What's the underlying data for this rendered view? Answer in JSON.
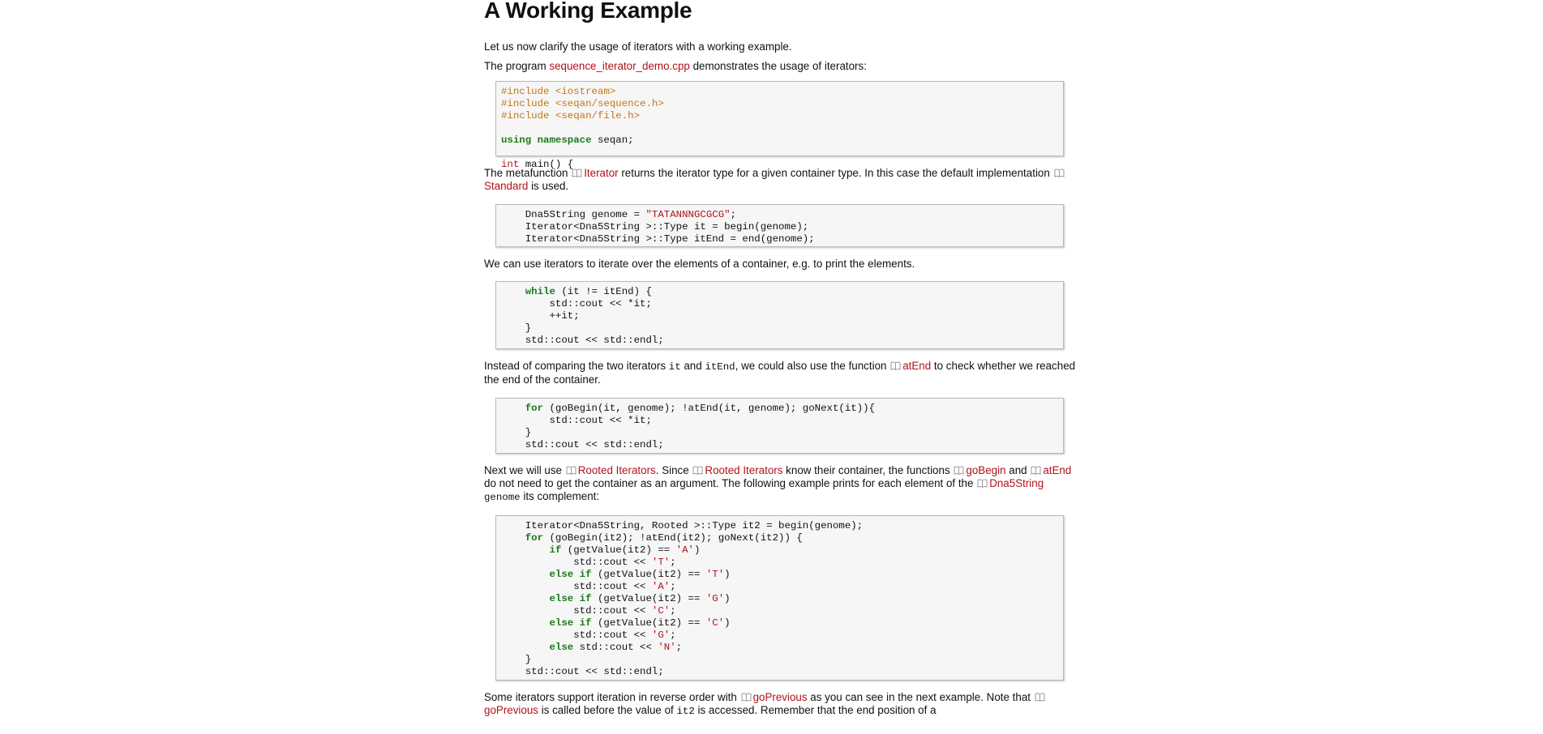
{
  "section": {
    "title": "A Working Example"
  },
  "p1": {
    "text": "Let us now clarify the usage of iterators with a working example."
  },
  "p2": {
    "before": "The program ",
    "link": "sequence_iterator_demo.cpp",
    "after": " demonstrates the usage of iterators:"
  },
  "code1": {
    "include1": "#include <iostream>",
    "include2": "#include <seqan/sequence.h>",
    "include3": "#include <seqan/file.h>",
    "kw_using": "using",
    "kw_namespace": "namespace",
    "ns": " seqan;",
    "kw_int": "int",
    "main": " main() {"
  },
  "p3": {
    "before": "The metafunction ",
    "link1": "Iterator",
    "middle": " returns the iterator type for a given container type. In this case the default implementation ",
    "link2": "Standard",
    "after": " is used."
  },
  "code2": {
    "l1a": "    Dna5String genome = ",
    "l1s": "\"TATANNNGCGCG\"",
    "l1b": ";",
    "l2": "    Iterator<Dna5String >::Type it = begin(genome);",
    "l3": "    Iterator<Dna5String >::Type itEnd = end(genome);"
  },
  "p4": {
    "text": "We can use iterators to iterate over the elements of a container, e.g. to print the elements."
  },
  "code3": {
    "kw_while": "while",
    "l1": " (it != itEnd) {",
    "l2": "        std::cout << *it;",
    "l3": "        ++it;",
    "l4": "    }",
    "l5": "    std::cout << std::endl;"
  },
  "p5": {
    "before": "Instead of comparing the two iterators ",
    "code1": "it",
    "and": " and ",
    "code2": "itEnd",
    "middle": ", we could also use the function ",
    "link": "atEnd",
    "after": " to check whether we reached the end of the container."
  },
  "code4": {
    "kw_for": "for",
    "l1": " (goBegin(it, genome); !atEnd(it, genome); goNext(it)){",
    "l2": "        std::cout << *it;",
    "l3": "    }",
    "l4": "    std::cout << std::endl;"
  },
  "p6": {
    "t1": "Next we will use ",
    "link1": "Rooted Iterators",
    "t2": ". Since ",
    "link2": "Rooted Iterators",
    "t3": " know their container, the functions ",
    "link3": "goBegin",
    "t4": " and ",
    "link4": "atEnd",
    "t5": " do not need to get the container as an argument. The following example prints for each element of the ",
    "link5": "Dna5String",
    "code": "genome",
    "t6": " its complement:"
  },
  "code5": {
    "l1": "    Iterator<Dna5String, Rooted >::Type it2 = begin(genome);",
    "kw_for": "for",
    "l2": " (goBegin(it2); !atEnd(it2); goNext(it2)) {",
    "kw_if": "if",
    "kw_else": "else",
    "kw_elseif": "else if",
    "c1": " (getValue(it2) == ",
    "c_end": ")",
    "out": "            std::cout << ",
    "semi": ";",
    "chA": "'A'",
    "chT": "'T'",
    "chG": "'G'",
    "chC": "'C'",
    "chN": "'N'",
    "else_out": " std::cout << ",
    "close": "    }",
    "endl": "    std::cout << std::endl;"
  },
  "p7": {
    "t1": "Some iterators support iteration in reverse order with ",
    "link1": "goPrevious",
    "t2": " as you can see in the next example. Note that ",
    "link2": "goPrevious",
    "t3": " is called before the value of ",
    "code": "it2",
    "t4": " is accessed. Remember that the end position of a"
  },
  "icons": {
    "doc_link_icon": "book-icon"
  },
  "colors": {
    "link": "#b0121b",
    "keyword": "#1a7a1a",
    "preprocessor": "#c2771a",
    "string": "#b0121b"
  }
}
